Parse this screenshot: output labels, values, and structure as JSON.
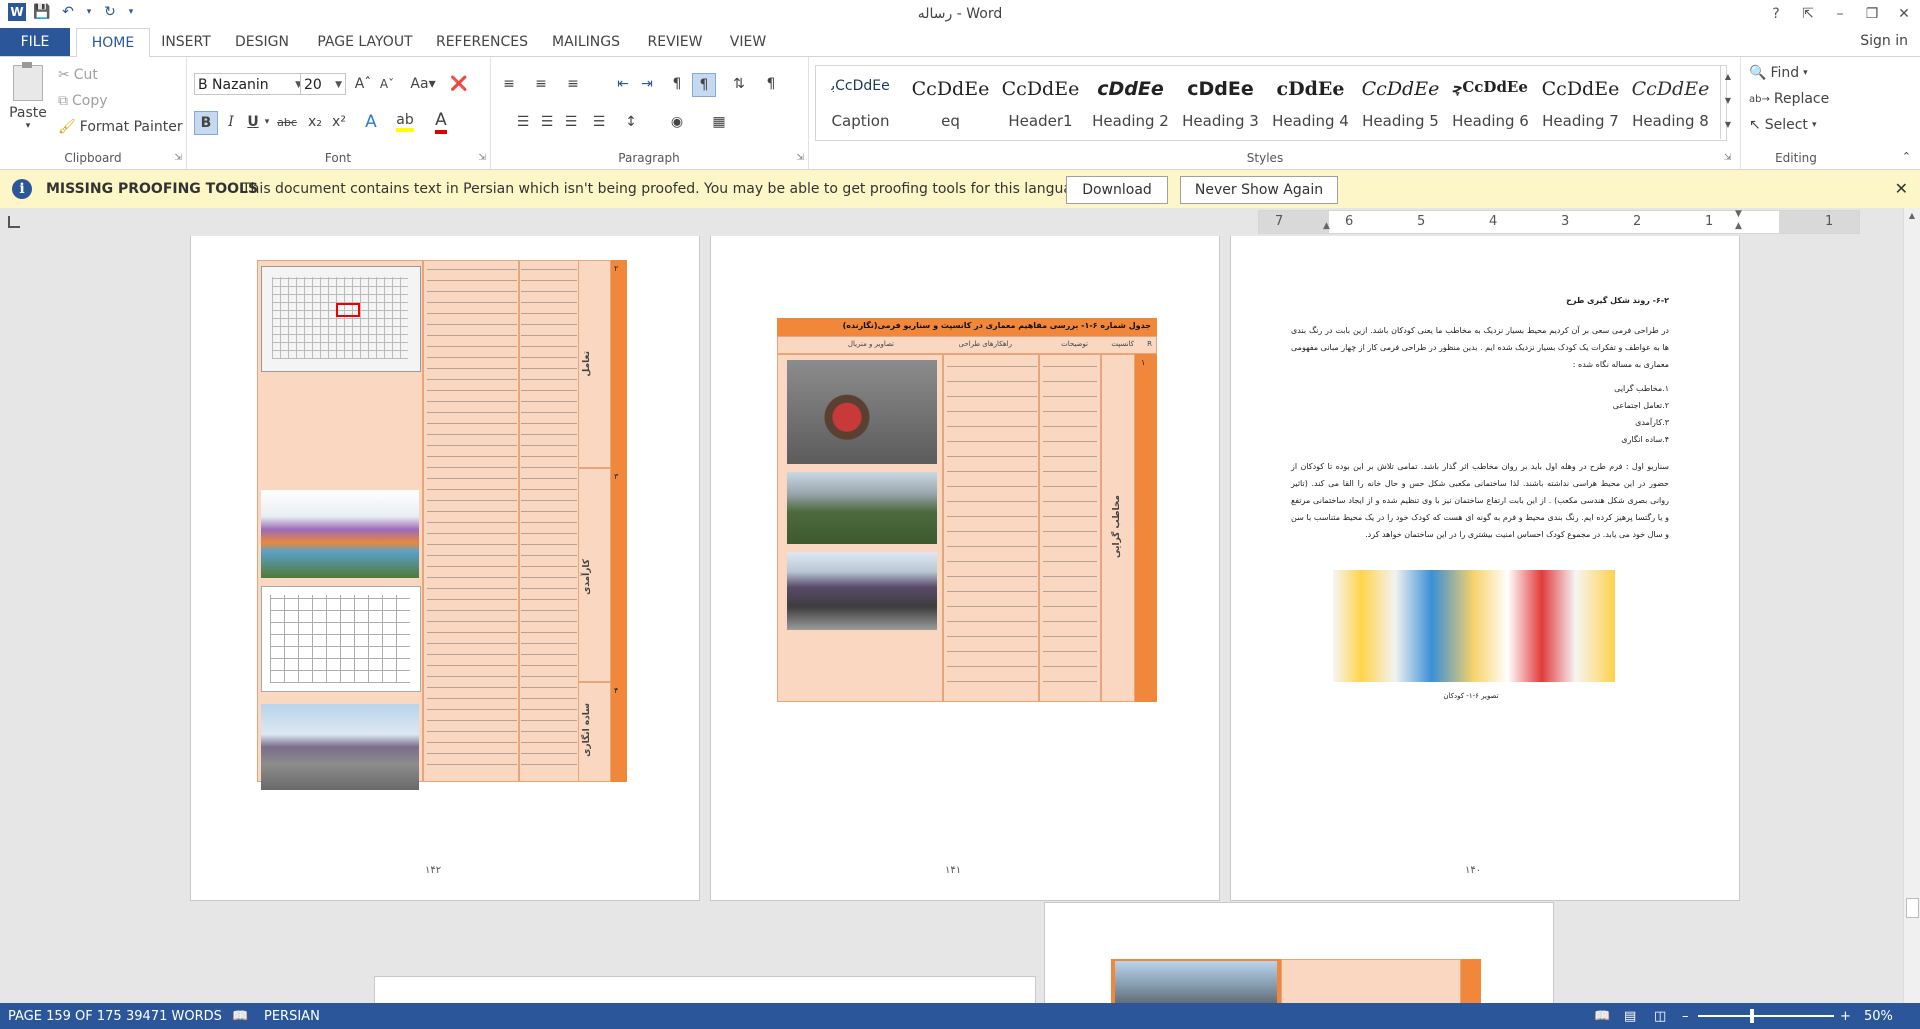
{
  "window": {
    "title": "رساله - Word"
  },
  "tabs": [
    "FILE",
    "HOME",
    "INSERT",
    "DESIGN",
    "PAGE LAYOUT",
    "REFERENCES",
    "MAILINGS",
    "REVIEW",
    "VIEW"
  ],
  "account": {
    "sign_in": "Sign in"
  },
  "clipboard": {
    "paste": "Paste",
    "cut": "Cut",
    "copy": "Copy",
    "format_painter": "Format Painter",
    "group_label": "Clipboard"
  },
  "font": {
    "name": "B Nazanin",
    "size": "20",
    "group_label": "Font",
    "bold": "B",
    "italic": "I",
    "underline": "U"
  },
  "paragraph": {
    "group_label": "Paragraph"
  },
  "styles": {
    "group_label": "Styles",
    "items": [
      {
        "sample": "ﺑCcDdEe",
        "name": "Caption"
      },
      {
        "sample": "CcDdEe",
        "name": "eq"
      },
      {
        "sample": "CcDdEe",
        "name": "Header1"
      },
      {
        "sample": "cDdEe",
        "name": "Heading 2"
      },
      {
        "sample": "cDdEe",
        "name": "Heading 3"
      },
      {
        "sample": "cDdEe",
        "name": "Heading 4"
      },
      {
        "sample": "CcDdEe",
        "name": "Heading 5"
      },
      {
        "sample": "ﭼCcDdEe",
        "name": "Heading 6"
      },
      {
        "sample": "CcDdEe",
        "name": "Heading 7"
      },
      {
        "sample": "CcDdEe",
        "name": "Heading 8"
      }
    ]
  },
  "editing": {
    "find": "Find",
    "replace": "Replace",
    "select": "Select",
    "group_label": "Editing"
  },
  "message_bar": {
    "title": "MISSING PROOFING TOOLS",
    "text": "This document contains text in Persian which isn't being proofed. You may be able to get proofing tools for this language.",
    "download": "Download",
    "never_show": "Never Show Again"
  },
  "ruler": {
    "numbers": [
      "7",
      "6",
      "5",
      "4",
      "3",
      "2",
      "1",
      "1"
    ]
  },
  "pages": {
    "left_page_number": "۱۴۲",
    "middle_page_number": "۱۴۱",
    "right_page_number": "۱۴۰",
    "right_heading": "۶-۲- روند شکل گیری طرح",
    "right_paragraph1": "در طراحی فرمی سعی بر آن کردیم محیط بسیار نزدیک به مخاطب ما یعنی کودکان باشد. ازین بابت در رنگ بندی ها به عواطف و تفکرات یک کودک بسیار نزدیک شده ایم . بدین منظور در طراحی فرمی کار از چهار مبانی مفهومی معماری به مساله نگاه شده :",
    "right_list": [
      "۱.مخاطب گرایی",
      "۲.تعامل اجتماعی",
      "۳.کارآمدی",
      "۴.ساده انگاری"
    ],
    "right_paragraph2": "سناریو اول : فرم طرح در وهله اول باید بر روان مخاطب اثر گذار باشد. تمامی تلاش بر این بوده تا کودکان از حضور در این محیط هراسی نداشته باشند. لذا ساختمانی مکعبی شکل حس و حال خانه را القا می کند. (تاثیر روانی بصری شکل هندسی مکعب) . از این بابت ارتفاع ساختمان نیز با وی تنظیم شده و از ایجاد ساختمانی مرتفع و یا رگتسا پرهیز کرده ایم. رنگ بندی محیط و فرم به گونه ای هست که کودک خود را در یک محیط متناسب با سن و سال خود می یابد. در مجموع کودک احساس امنیت بیشتری را در این ساختمان خواهد کرد.",
    "right_caption": "تصویر ۶-۱- کودکان",
    "middle_table_title": "جدول شماره ۶-۱- بررسی مفاهیم معماری در کانسپت و سناریو فرمی(نگارنده)",
    "middle_headers": [
      "R",
      "کانسپت",
      "توضیحات",
      "راهکارهای طراحی",
      "تصاویر و متریال"
    ],
    "middle_concept": "مخاطب گرایی",
    "left_concepts": [
      "تعامل",
      "کارآمدی",
      "ساده انگاری"
    ],
    "left_rows": [
      "۲",
      "۳",
      "۴"
    ],
    "middle_row": "۱"
  },
  "status": {
    "page": "PAGE 159 OF 175",
    "words": "39471 WORDS",
    "language": "PERSIAN",
    "zoom": "50%"
  }
}
